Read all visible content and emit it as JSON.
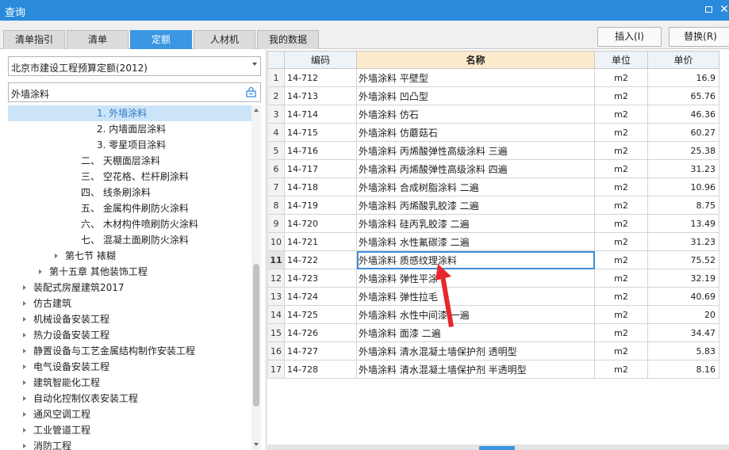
{
  "window": {
    "title": "查询"
  },
  "tabs": [
    {
      "label": "清单指引",
      "active": false
    },
    {
      "label": "清单",
      "active": false
    },
    {
      "label": "定额",
      "active": true
    },
    {
      "label": "人材机",
      "active": false
    },
    {
      "label": "我的数据",
      "active": false
    }
  ],
  "toolbar": {
    "insert_label": "插入(I)",
    "replace_label": "替换(R)"
  },
  "left_panel": {
    "library_select": "北京市建设工程预算定额(2012)",
    "search_value": "外墙涂料",
    "tree": [
      {
        "label": "1. 外墙涂料",
        "indent": 5,
        "expander": "none",
        "selected": true
      },
      {
        "label": "2. 内墙面层涂料",
        "indent": 5,
        "expander": "none",
        "selected": false
      },
      {
        "label": "3. 零星项目涂料",
        "indent": 5,
        "expander": "none",
        "selected": false
      },
      {
        "label": "二、 天棚面层涂料",
        "indent": 4,
        "expander": "none",
        "selected": false
      },
      {
        "label": "三、 空花格、栏杆刷涂料",
        "indent": 4,
        "expander": "none",
        "selected": false
      },
      {
        "label": "四、 线条刷涂料",
        "indent": 4,
        "expander": "none",
        "selected": false
      },
      {
        "label": "五、 金属构件刷防火涂料",
        "indent": 4,
        "expander": "none",
        "selected": false
      },
      {
        "label": "六、 木材构件喷刷防火涂料",
        "indent": 4,
        "expander": "none",
        "selected": false
      },
      {
        "label": "七、 混凝土面刷防火涂料",
        "indent": 4,
        "expander": "none",
        "selected": false
      },
      {
        "label": "第七节 裱糊",
        "indent": 3,
        "expander": "collapsed",
        "selected": false
      },
      {
        "label": "第十五章 其他装饰工程",
        "indent": 2,
        "expander": "collapsed",
        "selected": false
      },
      {
        "label": "装配式房屋建筑2017",
        "indent": 1,
        "expander": "collapsed",
        "selected": false
      },
      {
        "label": "仿古建筑",
        "indent": 1,
        "expander": "collapsed",
        "selected": false
      },
      {
        "label": "机械设备安装工程",
        "indent": 1,
        "expander": "collapsed",
        "selected": false
      },
      {
        "label": "热力设备安装工程",
        "indent": 1,
        "expander": "collapsed",
        "selected": false
      },
      {
        "label": "静置设备与工艺金属结构制作安装工程",
        "indent": 1,
        "expander": "collapsed",
        "selected": false
      },
      {
        "label": "电气设备安装工程",
        "indent": 1,
        "expander": "collapsed",
        "selected": false
      },
      {
        "label": "建筑智能化工程",
        "indent": 1,
        "expander": "collapsed",
        "selected": false
      },
      {
        "label": "自动化控制仪表安装工程",
        "indent": 1,
        "expander": "collapsed",
        "selected": false
      },
      {
        "label": "通风空调工程",
        "indent": 1,
        "expander": "collapsed",
        "selected": false
      },
      {
        "label": "工业管道工程",
        "indent": 1,
        "expander": "collapsed",
        "selected": false
      },
      {
        "label": "消防工程",
        "indent": 1,
        "expander": "collapsed",
        "selected": false
      }
    ]
  },
  "table": {
    "columns": [
      "编码",
      "名称",
      "单位",
      "单价"
    ],
    "current_row": 11,
    "rows": [
      {
        "num": "1",
        "code": "14-712",
        "name": "外墙涂料 平壁型",
        "unit": "m2",
        "price": "16.9"
      },
      {
        "num": "2",
        "code": "14-713",
        "name": "外墙涂料 凹凸型",
        "unit": "m2",
        "price": "65.76"
      },
      {
        "num": "3",
        "code": "14-714",
        "name": "外墙涂料 仿石",
        "unit": "m2",
        "price": "46.36"
      },
      {
        "num": "4",
        "code": "14-715",
        "name": "外墙涂料 仿蘑菇石",
        "unit": "m2",
        "price": "60.27"
      },
      {
        "num": "5",
        "code": "14-716",
        "name": "外墙涂料 丙烯酸弹性高级涂料 三遍",
        "unit": "m2",
        "price": "25.38"
      },
      {
        "num": "6",
        "code": "14-717",
        "name": "外墙涂料 丙烯酸弹性高级涂料 四遍",
        "unit": "m2",
        "price": "31.23"
      },
      {
        "num": "7",
        "code": "14-718",
        "name": "外墙涂料 合成树脂涂料 二遍",
        "unit": "m2",
        "price": "10.96"
      },
      {
        "num": "8",
        "code": "14-719",
        "name": "外墙涂料 丙烯酸乳胶漆 二遍",
        "unit": "m2",
        "price": "8.75"
      },
      {
        "num": "9",
        "code": "14-720",
        "name": "外墙涂料 硅丙乳胶漆 二遍",
        "unit": "m2",
        "price": "13.49"
      },
      {
        "num": "10",
        "code": "14-721",
        "name": "外墙涂料 水性氟碳漆 二遍",
        "unit": "m2",
        "price": "31.23"
      },
      {
        "num": "11",
        "code": "14-722",
        "name": "外墙涂料 质感纹理涂料",
        "unit": "m2",
        "price": "75.52"
      },
      {
        "num": "12",
        "code": "14-723",
        "name": "外墙涂料 弹性平涂",
        "unit": "m2",
        "price": "32.19"
      },
      {
        "num": "13",
        "code": "14-724",
        "name": "外墙涂料 弹性拉毛",
        "unit": "m2",
        "price": "40.69"
      },
      {
        "num": "14",
        "code": "14-725",
        "name": "外墙涂料 水性中间漆 一遍",
        "unit": "m2",
        "price": "20"
      },
      {
        "num": "15",
        "code": "14-726",
        "name": "外墙涂料 面漆 二遍",
        "unit": "m2",
        "price": "34.47"
      },
      {
        "num": "16",
        "code": "14-727",
        "name": "外墙涂料 清水混凝土墙保护剂 透明型",
        "unit": "m2",
        "price": "5.83"
      },
      {
        "num": "17",
        "code": "14-728",
        "name": "外墙涂料 清水混凝土墙保护剂 半透明型",
        "unit": "m2",
        "price": "8.16"
      }
    ]
  },
  "colors": {
    "titlebar": "#2a8bdc",
    "tab_active": "#3b97e3",
    "selection": "#cce4f7",
    "header_highlight": "#fde9cc",
    "annotation_arrow": "#e8262e"
  },
  "icons": {
    "restore": "restore-icon",
    "close": "close-icon",
    "search": "search-icon",
    "dropdown": "chevron-down-icon"
  }
}
